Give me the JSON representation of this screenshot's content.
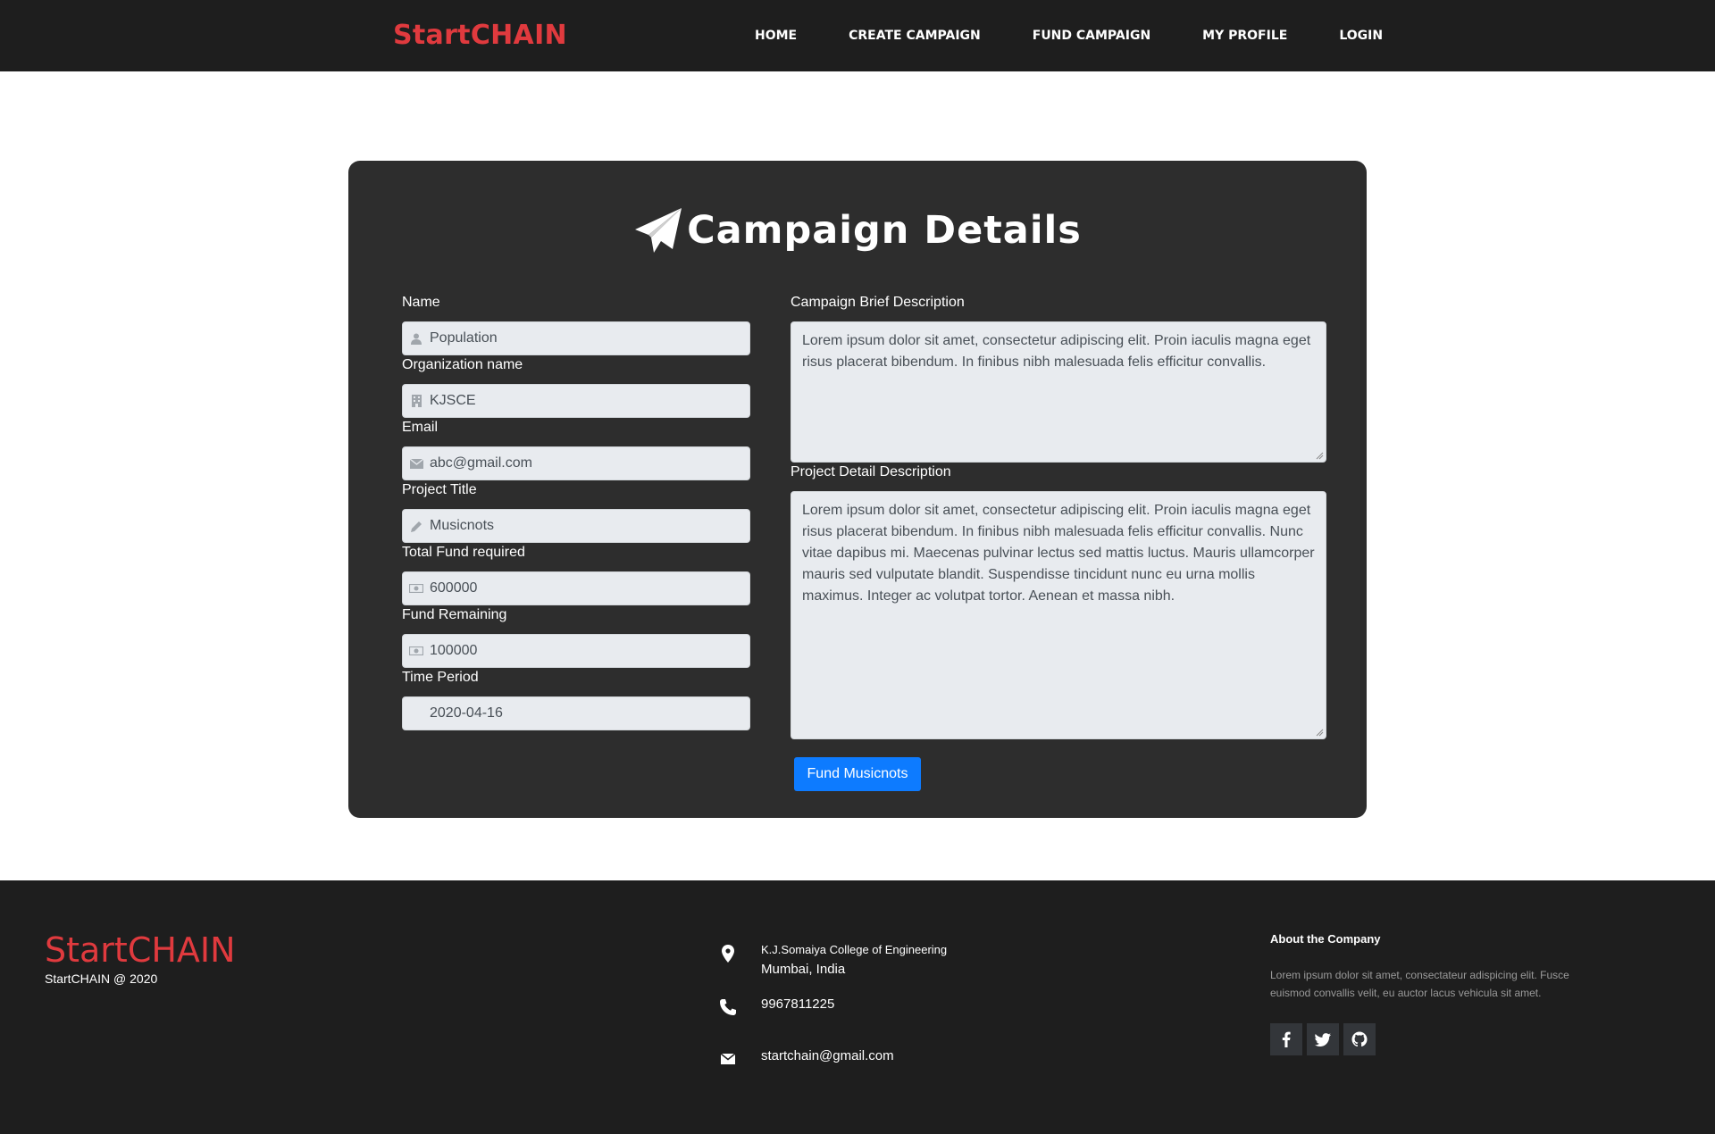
{
  "navbar": {
    "brand": "StartCHAIN",
    "links": [
      "HOME",
      "CREATE CAMPAIGN",
      "FUND CAMPAIGN",
      "MY PROFILE",
      "LOGIN"
    ]
  },
  "card": {
    "title": "Campaign Details",
    "title_icon": "paper-plane-icon",
    "fields": {
      "name": {
        "label": "Name",
        "value": "Population",
        "icon": "user-icon"
      },
      "organization": {
        "label": "Organization name",
        "value": "KJSCE",
        "icon": "building-icon"
      },
      "email": {
        "label": "Email",
        "value": "abc@gmail.com",
        "icon": "envelope-icon"
      },
      "project_title": {
        "label": "Project Title",
        "value": "Musicnots",
        "icon": "pencil-icon"
      },
      "total_fund": {
        "label": "Total Fund required",
        "value": "600000",
        "icon": "money-icon"
      },
      "fund_remaining": {
        "label": "Fund Remaining",
        "value": "100000",
        "icon": "money-icon"
      },
      "time_period": {
        "label": "Time Period",
        "value": "2020-04-16"
      }
    },
    "brief_description": {
      "label": "Campaign Brief Description",
      "value": "Lorem ipsum dolor sit amet, consectetur adipiscing elit. Proin iaculis magna eget risus placerat bibendum. In finibus nibh malesuada felis efficitur convallis."
    },
    "detail_description": {
      "label": "Project Detail Description",
      "value": "Lorem ipsum dolor sit amet, consectetur adipiscing elit. Proin iaculis magna eget risus placerat bibendum. In finibus nibh malesuada felis efficitur convallis. Nunc vitae dapibus mi. Maecenas pulvinar lectus sed mattis luctus. Mauris ullamcorper mauris sed vulputate blandit. Suspendisse tincidunt nunc eu urna mollis maximus. Integer ac volutpat tortor. Aenean et massa nibh."
    },
    "fund_button": "Fund Musicnots"
  },
  "footer": {
    "brand": "StartCHAIN",
    "copyright": "StartCHAIN @ 2020",
    "address_line1": "K.J.Somaiya College of Engineering",
    "address_line2": "Mumbai, India",
    "phone": "9967811225",
    "email": "startchain@gmail.com",
    "about_title": "About the Company",
    "about_text": "Lorem ipsum dolor sit amet, consectateur adispicing elit. Fusce euismod convallis velit, eu auctor lacus vehicula sit amet.",
    "socials": [
      "facebook-icon",
      "twitter-icon",
      "github-icon"
    ]
  },
  "colors": {
    "brand_red": "#e03a3e",
    "nav_bg": "#1e1e1e",
    "card_bg": "#2d2d2d",
    "button_blue": "#0d7bff",
    "input_bg": "#e8ebef"
  }
}
